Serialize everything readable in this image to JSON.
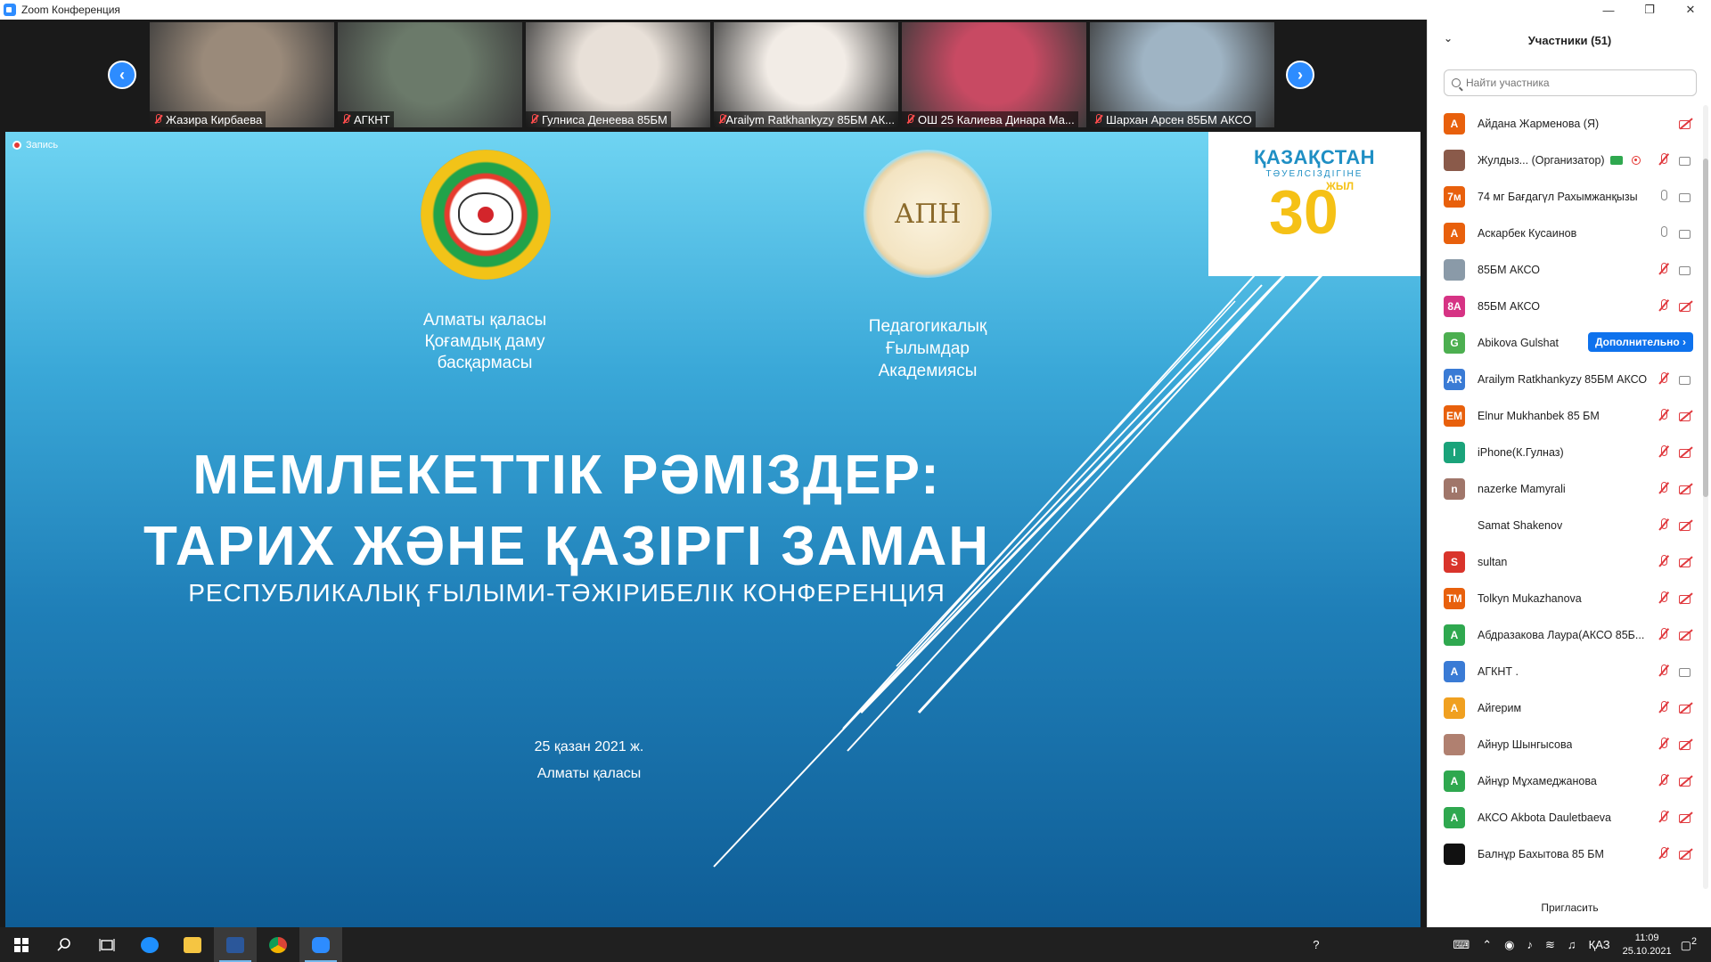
{
  "window": {
    "title": "Zoom Конференция",
    "min": "—",
    "max": "❐",
    "close": "✕"
  },
  "thumbnails": [
    {
      "name": "Жазира Кирбаева",
      "bg": "#9a8a7a"
    },
    {
      "name": "АГКНТ",
      "bg": "#6b7a6a"
    },
    {
      "name": "Гулниса Денеева 85БМ",
      "bg": "#e8e0d8"
    },
    {
      "name": "Arailym Ratkhankyzy 85БМ АК...",
      "bg": "#f2ece6"
    },
    {
      "name": "ОШ 25 Калиева Динара Ма...",
      "bg": "#c84a63"
    },
    {
      "name": "Шархан Арсен 85БМ АКСО",
      "bg": "#9fb4c4"
    }
  ],
  "nav": {
    "prev": "‹",
    "next": "›"
  },
  "recording": {
    "label": "Запись"
  },
  "slide": {
    "org_left": [
      "Алматы қаласы",
      "Қоғамдық даму",
      "басқармасы"
    ],
    "apn_logo": "АПН",
    "org_right": [
      "Педагогикалық",
      "Ғылымдар",
      "Академиясы"
    ],
    "kz30": {
      "line1": "ҚАЗАҚСТАН",
      "line2": "ТӘУЕЛСІЗДІГІНЕ",
      "number": "30",
      "suffix": "ЖЫЛ"
    },
    "title_line1": "МЕМЛЕКЕТТІК РӘМІЗДЕР:",
    "title_line2": "ТАРИХ ЖӘНЕ ҚАЗІРГІ ЗАМАН",
    "subtitle": "РЕСПУБЛИКАЛЫҚ ҒЫЛЫМИ-ТӘЖІРИБЕЛІК КОНФЕРЕНЦИЯ",
    "date": "25 қазан 2021 ж.",
    "city": "Алматы қаласы"
  },
  "panel": {
    "title": "Участники (51)",
    "collapse_icon": "⌄",
    "search_placeholder": "Найти участника",
    "more_label": "Дополнительно ›",
    "invite_label": "Пригласить",
    "participants": [
      {
        "initials": "А",
        "color": "#e8600c",
        "name": "Айдана Жарменова (Я)",
        "mic": "none",
        "cam": "off"
      },
      {
        "initials": "",
        "color": "#8a5a4a",
        "name": "Жулдыз... (Организатор)",
        "mic": "off",
        "cam": "on",
        "organizer": true
      },
      {
        "initials": "7м",
        "color": "#e8600c",
        "name": "74 мг Бағдагүл Рахымжанқызы",
        "mic": "on",
        "cam": "on"
      },
      {
        "initials": "А",
        "color": "#e8600c",
        "name": "Аскарбек Кусаинов",
        "mic": "on",
        "cam": "on"
      },
      {
        "initials": "",
        "color": "#8a9aa8",
        "name": "85БМ АКСО",
        "mic": "off",
        "cam": "on"
      },
      {
        "initials": "8А",
        "color": "#d63384",
        "name": "85БМ АКСО",
        "mic": "off",
        "cam": "off"
      },
      {
        "initials": "G",
        "color": "#4caf50",
        "name": "Abikova Gulshat",
        "mic": "none",
        "cam": "none",
        "more": true
      },
      {
        "initials": "AR",
        "color": "#3a7bd5",
        "name": "Arailym Ratkhankyzy 85БМ АКСО",
        "mic": "off",
        "cam": "on"
      },
      {
        "initials": "EM",
        "color": "#e8600c",
        "name": "Elnur Mukhanbek 85 БМ",
        "mic": "off",
        "cam": "off"
      },
      {
        "initials": "I",
        "color": "#1aa37a",
        "name": "iPhone(К.Гулназ)",
        "mic": "off",
        "cam": "off"
      },
      {
        "initials": "n",
        "color": "#a0766a",
        "name": "nazerke Mamyrali",
        "mic": "off",
        "cam": "off"
      },
      {
        "initials": "",
        "color": "#ffffff",
        "name": "Samat Shakenov",
        "mic": "off",
        "cam": "off"
      },
      {
        "initials": "S",
        "color": "#d9342b",
        "name": "sultan",
        "mic": "off",
        "cam": "off"
      },
      {
        "initials": "TM",
        "color": "#e8600c",
        "name": "Tolkyn Mukazhanova",
        "mic": "off",
        "cam": "off"
      },
      {
        "initials": "А",
        "color": "#2fa84f",
        "name": "Абдразакова Лаура(АКСО 85Б...",
        "mic": "off",
        "cam": "off"
      },
      {
        "initials": "А",
        "color": "#3a7bd5",
        "name": "АГКНТ .",
        "mic": "off",
        "cam": "on"
      },
      {
        "initials": "А",
        "color": "#f0a020",
        "name": "Айгерим",
        "mic": "off",
        "cam": "off"
      },
      {
        "initials": "",
        "color": "#b08070",
        "name": "Айнур Шынгысова",
        "mic": "off",
        "cam": "off"
      },
      {
        "initials": "А",
        "color": "#2fa84f",
        "name": "Айнұр Мұхамеджанова",
        "mic": "off",
        "cam": "off"
      },
      {
        "initials": "А",
        "color": "#2fa84f",
        "name": "АКСО Akbota Dauletbaeva",
        "mic": "off",
        "cam": "off"
      },
      {
        "initials": "",
        "color": "#111111",
        "name": "Балнұр Бахытова 85 БМ",
        "mic": "off",
        "cam": "off"
      }
    ]
  },
  "taskbar": {
    "lang": "ҚАЗ",
    "time": "11:09",
    "date": "25.10.2021",
    "notifications": "2"
  }
}
